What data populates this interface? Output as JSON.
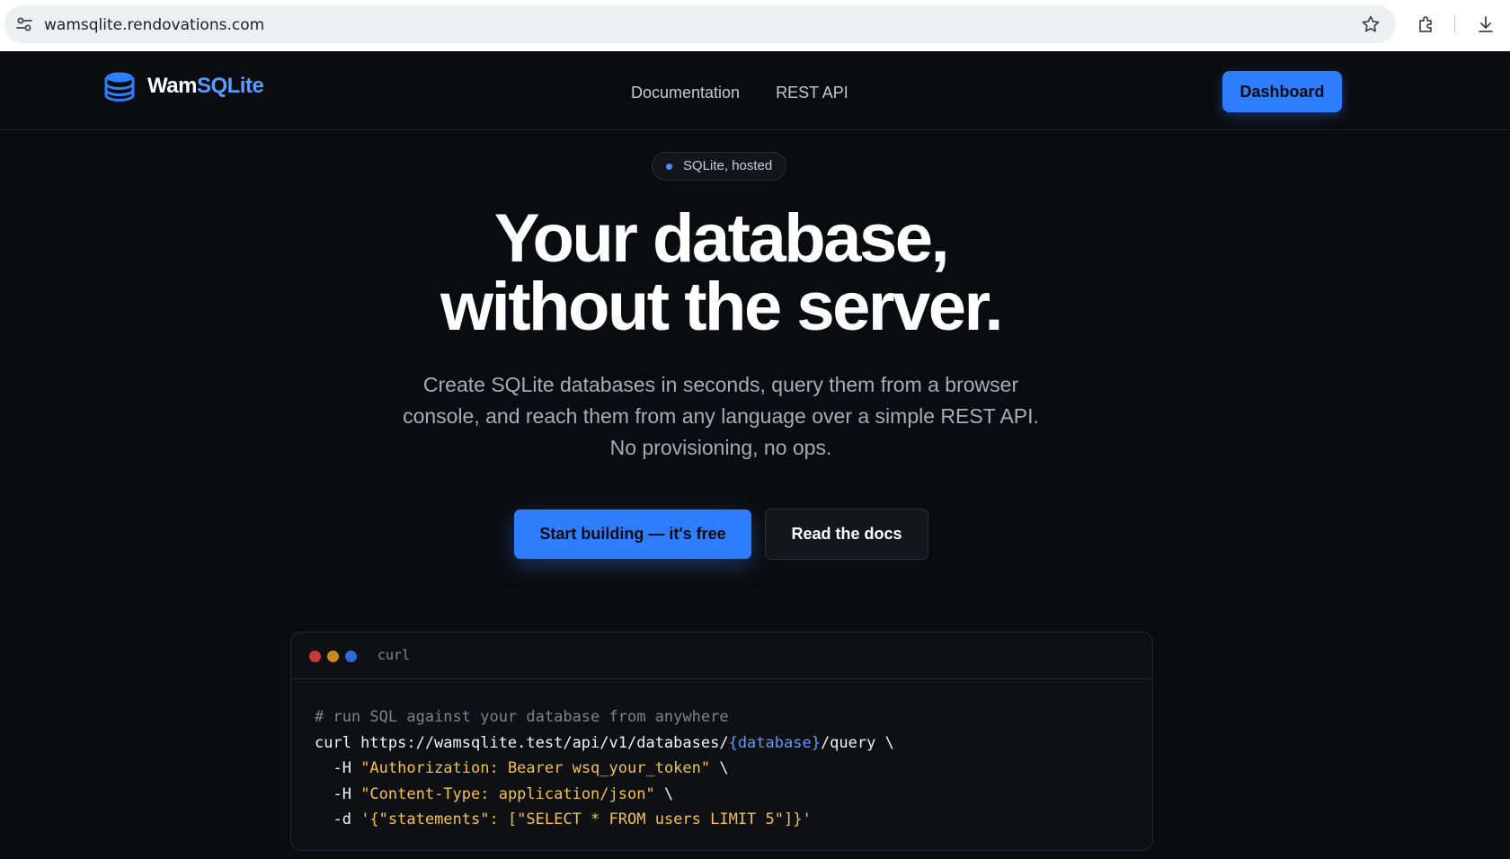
{
  "browser": {
    "url": "wamsqlite.rendovations.com"
  },
  "nav": {
    "brand_part1": "Wam",
    "brand_part2": "SQLite",
    "links": [
      "Documentation",
      "REST API"
    ],
    "dashboard_label": "Dashboard"
  },
  "hero": {
    "badge": "SQLite, hosted",
    "headline_line1": "Your database,",
    "headline_line2": "without the server.",
    "subhead": "Create SQLite databases in seconds, query them from a browser console, and reach them from any language over a simple REST API. No provisioning, no ops.",
    "cta_primary": "Start building — it's free",
    "cta_secondary": "Read the docs"
  },
  "code": {
    "tab_label": "curl",
    "window_dot_colors": [
      "#c73a3a",
      "#c98a18",
      "#2f6bd6"
    ],
    "comment": "# run SQL against your database from anywhere",
    "line1_a": "curl https://wamsqlite.test/api/v1/databases/",
    "line1_var": "{database}",
    "line1_b": "/query \\",
    "line2_flag": "  -H ",
    "line2_str": "\"Authorization: Bearer wsq_your_token\"",
    "line2_end": " \\",
    "line3_flag": "  -H ",
    "line3_str": "\"Content-Type: application/json\"",
    "line3_end": " \\",
    "line4_flag": "  -d ",
    "line4_str": "'{\"statements\": [\"SELECT * FROM users LIMIT 5\"]}'"
  },
  "colors": {
    "accent": "#2f7dff",
    "brand_blue": "#5a9bff",
    "background": "#0b0c0f",
    "string_yellow": "#f2c14e"
  }
}
